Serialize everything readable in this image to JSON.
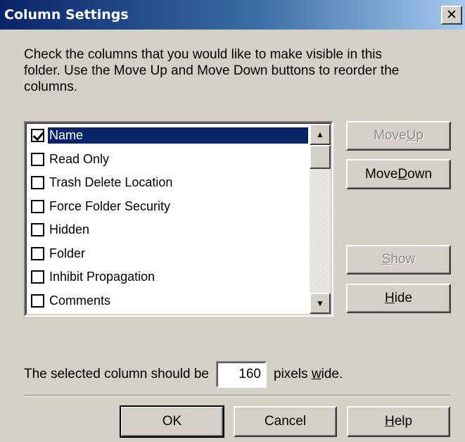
{
  "window": {
    "title": "Column Settings",
    "close_glyph": "✕"
  },
  "instructions": {
    "line1": "Check the columns that you would like to make visible in this",
    "line2": "folder.  Use the Move Up and Move Down buttons to reorder the",
    "line3": "columns."
  },
  "columns": [
    {
      "label": "Name",
      "checked": true,
      "selected": true
    },
    {
      "label": "Read Only",
      "checked": false,
      "selected": false
    },
    {
      "label": "Trash Delete Location",
      "checked": false,
      "selected": false
    },
    {
      "label": "Force Folder Security",
      "checked": false,
      "selected": false
    },
    {
      "label": "Hidden",
      "checked": false,
      "selected": false
    },
    {
      "label": "Folder",
      "checked": false,
      "selected": false
    },
    {
      "label": "Inhibit Propagation",
      "checked": false,
      "selected": false
    },
    {
      "label": "Comments",
      "checked": false,
      "selected": false
    }
  ],
  "scrollbar": {
    "up_glyph": "▲",
    "down_glyph": "▼"
  },
  "buttons": {
    "move_up": {
      "pre": "Move ",
      "accel": "U",
      "post": "p",
      "enabled": false
    },
    "move_down": {
      "pre": "Move ",
      "accel": "D",
      "post": "own",
      "enabled": true
    },
    "show": {
      "pre": "",
      "accel": "S",
      "post": "how",
      "enabled": false
    },
    "hide": {
      "pre": "",
      "accel": "H",
      "post": "ide",
      "enabled": true
    },
    "ok": {
      "label": "OK"
    },
    "cancel": {
      "label": "Cancel"
    },
    "help": {
      "pre": "",
      "accel": "H",
      "post": "elp"
    }
  },
  "width_setting": {
    "prefix": "The selected column should be",
    "value": "160",
    "suffix_pre": "pixels ",
    "suffix_accel": "w",
    "suffix_post": "ide."
  },
  "colors": {
    "dialog_bg": "#d4d0c8",
    "title_start": "#0a246a",
    "title_end": "#a6caf0",
    "selection": "#0a246a"
  }
}
